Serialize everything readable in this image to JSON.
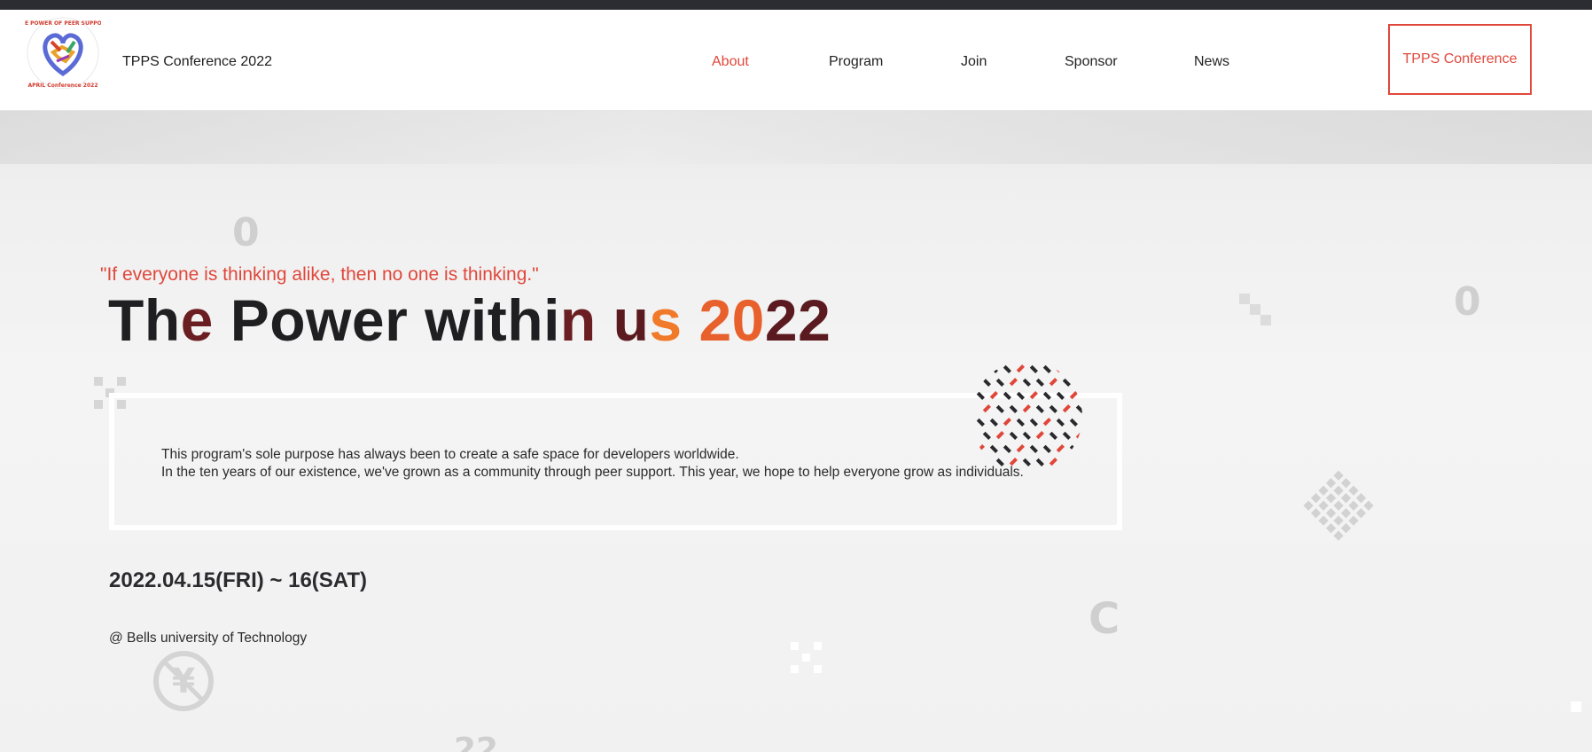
{
  "header": {
    "site_title": "TPPS Conference 2022",
    "logo_alt": "THE POWER OF PEER SUPPORT - APRIL Conference 2022",
    "nav": [
      {
        "label": "About",
        "active": true
      },
      {
        "label": "Program",
        "active": false
      },
      {
        "label": "Join",
        "active": false
      },
      {
        "label": "Sponsor",
        "active": false
      },
      {
        "label": "News",
        "active": false
      }
    ],
    "cta_label": "TPPS Conference"
  },
  "hero": {
    "quote": "\"If everyone is thinking alike, then no one is thinking.\"",
    "headline": {
      "part1": "Th",
      "part2": "e",
      "part3": " Power withi",
      "part4": "n ",
      "part5": "u",
      "part6": "s ",
      "part7": "20",
      "part8": "22"
    },
    "description": {
      "line1": "This program's sole purpose has always been to create a safe space for developers worldwide.",
      "line2": "In the ten years of our existence, we've grown as a community through peer support. This year, we hope to help everyone grow as individuals."
    },
    "dates": "2022.04.15(FRI) ~ 16(SAT)",
    "venue": "@ Bells university of Technology"
  },
  "colors": {
    "accent": "#e0473b",
    "dark": "#1f1f22",
    "maroon": "#6b1e22",
    "orange": "#e8602c"
  },
  "decorations": {
    "zero_glyph": "0",
    "c_glyph": "C",
    "yen_glyph": "¥",
    "x_glyph": "✕",
    "partial_number": "22"
  }
}
